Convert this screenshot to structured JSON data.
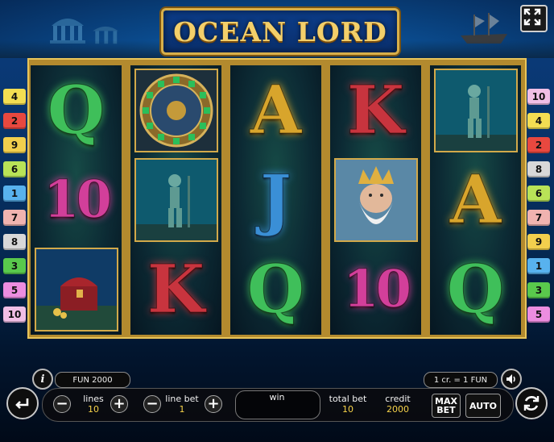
{
  "game": {
    "title": "OCEAN LORD"
  },
  "left_lines": [
    {
      "label": "4",
      "color": "#f3de52"
    },
    {
      "label": "2",
      "color": "#e8483f"
    },
    {
      "label": "9",
      "color": "#f2cf4d"
    },
    {
      "label": "6",
      "color": "#b9e357"
    },
    {
      "label": "1",
      "color": "#58b2ee"
    },
    {
      "label": "7",
      "color": "#f0b3b0"
    },
    {
      "label": "8",
      "color": "#d8d8d8"
    },
    {
      "label": "3",
      "color": "#59c94c"
    },
    {
      "label": "5",
      "color": "#ec8de0"
    },
    {
      "label": "10",
      "color": "#f1bfe6"
    }
  ],
  "right_lines": [
    {
      "label": "10",
      "color": "#f1bfe6"
    },
    {
      "label": "4",
      "color": "#f3de52"
    },
    {
      "label": "2",
      "color": "#e8483f"
    },
    {
      "label": "8",
      "color": "#d8d8d8"
    },
    {
      "label": "6",
      "color": "#b9e357"
    },
    {
      "label": "7",
      "color": "#f0b3b0"
    },
    {
      "label": "9",
      "color": "#f2cf4d"
    },
    {
      "label": "1",
      "color": "#58b2ee"
    },
    {
      "label": "3",
      "color": "#59c94c"
    },
    {
      "label": "5",
      "color": "#ec8de0"
    }
  ],
  "reels": [
    [
      {
        "symbol": "Q",
        "kind": "letter",
        "color": "#3fbf5a"
      },
      {
        "symbol": "10",
        "kind": "ten",
        "color": "#d23f9a"
      },
      {
        "symbol": "treasure-chest",
        "kind": "picture"
      }
    ],
    [
      {
        "symbol": "compass-medallion",
        "kind": "picture"
      },
      {
        "symbol": "mermaid-statue",
        "kind": "picture"
      },
      {
        "symbol": "K",
        "kind": "letter",
        "color": "#c8343e"
      }
    ],
    [
      {
        "symbol": "A",
        "kind": "letter",
        "color": "#d8a52c"
      },
      {
        "symbol": "J",
        "kind": "letter",
        "color": "#3a8fd6"
      },
      {
        "symbol": "Q",
        "kind": "letter",
        "color": "#3fbf5a"
      }
    ],
    [
      {
        "symbol": "K",
        "kind": "letter",
        "color": "#c8343e"
      },
      {
        "symbol": "ocean-lord-king",
        "kind": "picture"
      },
      {
        "symbol": "10",
        "kind": "ten",
        "color": "#d23f9a"
      }
    ],
    [
      {
        "symbol": "mermaid-statue",
        "kind": "picture"
      },
      {
        "symbol": "A",
        "kind": "letter",
        "color": "#d8a52c"
      },
      {
        "symbol": "Q",
        "kind": "letter",
        "color": "#3fbf5a"
      }
    ]
  ],
  "panel": {
    "fun_balance": "FUN 2000",
    "rate": "1 cr. = 1 FUN",
    "lines_label": "lines",
    "lines_value": "10",
    "line_bet_label": "line bet",
    "line_bet_value": "1",
    "win_label": "win",
    "total_bet_label": "total bet",
    "total_bet_value": "10",
    "credit_label": "credit",
    "credit_value": "2000",
    "max_bet_label": "MAX\nBET",
    "auto_label": "AUTO",
    "minus": "−",
    "plus": "+",
    "info": "i"
  }
}
